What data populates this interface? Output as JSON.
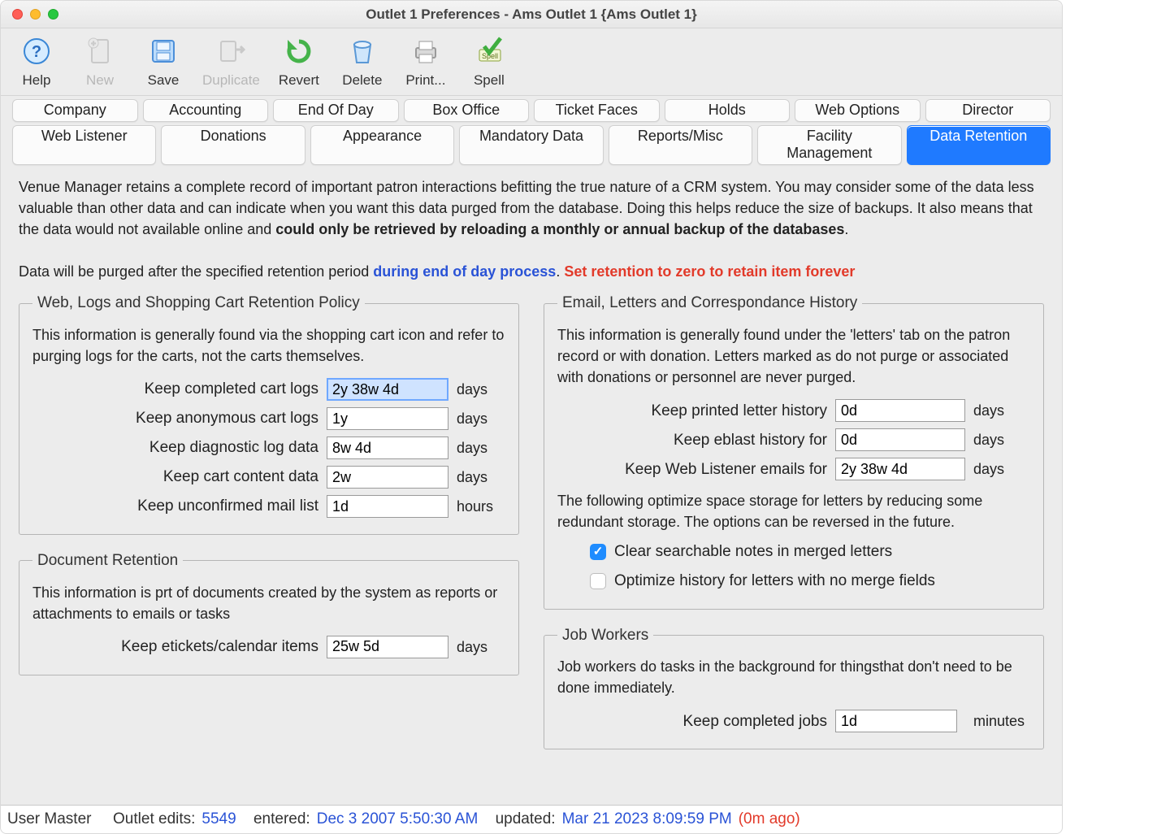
{
  "window": {
    "title": "Outlet 1 Preferences - Ams Outlet 1 {Ams Outlet 1}"
  },
  "toolbar": {
    "help": "Help",
    "new": "New",
    "save": "Save",
    "duplicate": "Duplicate",
    "revert": "Revert",
    "delete": "Delete",
    "print": "Print...",
    "spell": "Spell"
  },
  "tabs": {
    "row1": [
      "Company",
      "Accounting",
      "End Of Day",
      "Box Office",
      "Ticket Faces",
      "Holds",
      "Web Options",
      "Director"
    ],
    "row2": [
      "Web Listener",
      "Donations",
      "Appearance",
      "Mandatory Data",
      "Reports/Misc",
      "Facility Management",
      "Data Retention"
    ],
    "active": "Data Retention"
  },
  "intro": {
    "p1a": "Venue Manager retains a complete record of important patron interactions befitting the true nature of a CRM system.   You may consider some of the data less valuable than other data and can indicate when you want this data purged from the database.  Doing this helps reduce the size of backups.   It also means that the data would not available online and ",
    "p1b": "could only be retrieved by reloading a monthly or annual backup of the databases",
    "p1c": ".",
    "p2a": "Data will be purged after the specified retention period ",
    "p2b": "during end of day process",
    "p2c": ".   ",
    "p2d": "Set retention to zero to retain item forever"
  },
  "web": {
    "legend": "Web, Logs and Shopping Cart Retention Policy",
    "desc": "This information is generally found via the shopping cart icon and refer to purging logs for the carts, not the carts themselves.",
    "rows": [
      {
        "label": "Keep completed cart logs",
        "value": "2y 38w 4d",
        "unit": "days",
        "selected": true
      },
      {
        "label": "Keep anonymous cart logs",
        "value": "1y",
        "unit": "days"
      },
      {
        "label": "Keep diagnostic log data",
        "value": "8w 4d",
        "unit": "days"
      },
      {
        "label": "Keep cart content data",
        "value": "2w",
        "unit": "days"
      },
      {
        "label": "Keep unconfirmed mail list",
        "value": "1d",
        "unit": "hours"
      }
    ]
  },
  "doc": {
    "legend": "Document Retention",
    "desc": "This information is prt of documents created by the system as reports or attachments to emails or tasks",
    "rows": [
      {
        "label": "Keep etickets/calendar items",
        "value": "25w 5d",
        "unit": "days"
      }
    ]
  },
  "email": {
    "legend": "Email, Letters and Correspondance History",
    "desc": "This information is generally found under the 'letters' tab on the patron record or with donation.    Letters marked as do not purge or associated with donations or personnel are never purged.",
    "rows": [
      {
        "label": "Keep printed letter history",
        "value": "0d",
        "unit": "days"
      },
      {
        "label": "Keep eblast history for",
        "value": "0d",
        "unit": "days"
      },
      {
        "label": "Keep Web Listener emails for",
        "value": "2y 38w 4d",
        "unit": "days"
      }
    ],
    "note": "The following optimize space storage for letters by reducing some redundant storage.  The options can be reversed in the future.",
    "cb1": {
      "label": "Clear searchable notes in merged letters",
      "checked": true
    },
    "cb2": {
      "label": "Optimize history for letters with no merge fields",
      "checked": false
    }
  },
  "jobs": {
    "legend": "Job Workers",
    "desc": "Job workers do tasks in the background for thingsthat don't need to be done immediately.",
    "rows": [
      {
        "label": "Keep completed jobs",
        "value": "1d",
        "unit": "minutes"
      }
    ]
  },
  "status": {
    "user": "User Master",
    "edits_label": "Outlet edits:",
    "edits": "5549",
    "entered_label": "entered:",
    "entered": "Dec 3 2007 5:50:30 AM",
    "updated_label": "updated:",
    "updated": "Mar 21 2023 8:09:59 PM",
    "ago": "(0m ago)"
  }
}
